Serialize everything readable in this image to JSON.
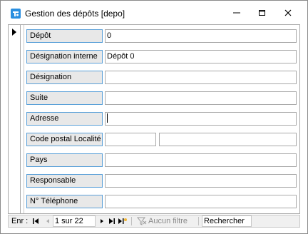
{
  "window": {
    "title": "Gestion des dépôts [depo]",
    "icon": "access-form-icon",
    "controls": [
      "minimize-icon",
      "maximize-icon",
      "close-icon"
    ]
  },
  "form": {
    "fields": [
      {
        "label": "Dépôt",
        "value": "0"
      },
      {
        "label": "Désignation interne",
        "value": "Dépôt 0"
      },
      {
        "label": "Désignation",
        "value": ""
      },
      {
        "label": "Suite",
        "value": ""
      },
      {
        "label": "Adresse",
        "value": ""
      },
      {
        "label": "Code postal Localité",
        "value": "",
        "value2": ""
      },
      {
        "label": "Pays",
        "value": ""
      },
      {
        "label": "Responsable",
        "value": ""
      },
      {
        "label": "N° Téléphone",
        "value": ""
      }
    ]
  },
  "navigation": {
    "label": "Enr :",
    "record": "1 sur 22",
    "filter": "Aucun filtre",
    "search": "Rechercher"
  },
  "colors": {
    "label_border": "#5aa0d8",
    "label_bg": "#e8e8e8",
    "icon_blue": "#2a8fe0"
  }
}
